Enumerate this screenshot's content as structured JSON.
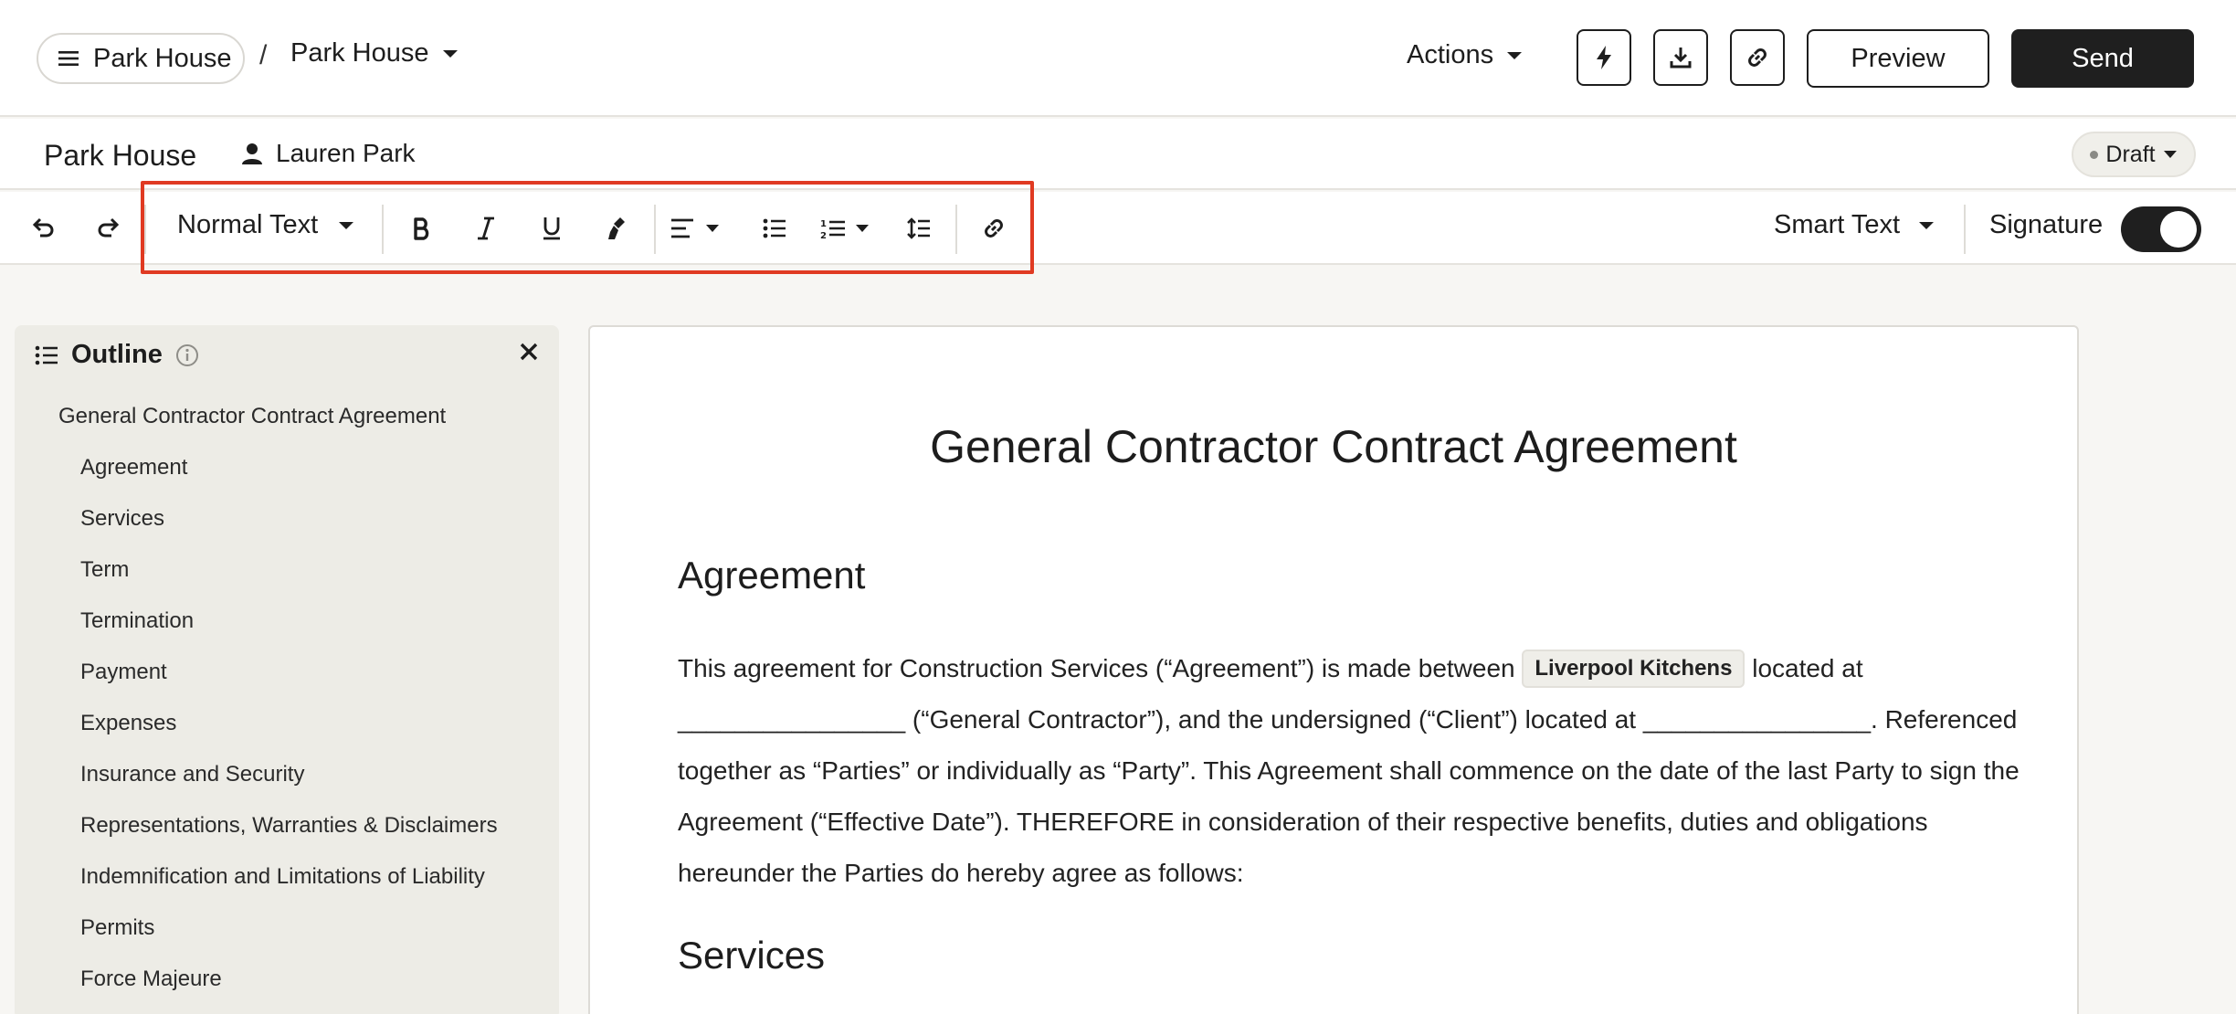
{
  "topbar": {
    "breadcrumb_root": "Park House",
    "breadcrumb_separator": "/",
    "breadcrumb_current": "Park House",
    "actions_label": "Actions",
    "preview_label": "Preview",
    "send_label": "Send",
    "icons": [
      "menu-icon",
      "lightning-icon",
      "download-icon",
      "link-icon",
      "caret-down-icon"
    ]
  },
  "docbar": {
    "document_name": "Park House",
    "owner_name": "Lauren Park",
    "status": "Draft"
  },
  "toolbar": {
    "text_style": "Normal Text",
    "smart_text_label": "Smart Text",
    "signature_label": "Signature",
    "signature_enabled": true,
    "icons": [
      "undo-icon",
      "redo-icon",
      "bold-icon",
      "italic-icon",
      "underline-icon",
      "clear-format-icon",
      "align-left-icon",
      "bullet-list-icon",
      "numbered-list-icon",
      "line-spacing-icon",
      "link-icon"
    ]
  },
  "outline": {
    "title": "Outline",
    "items": [
      {
        "label": "General Contractor Contract Agreement",
        "level": 1
      },
      {
        "label": "Agreement",
        "level": 2
      },
      {
        "label": "Services",
        "level": 2
      },
      {
        "label": "Term",
        "level": 2
      },
      {
        "label": "Termination",
        "level": 2
      },
      {
        "label": "Payment",
        "level": 2
      },
      {
        "label": "Expenses",
        "level": 2
      },
      {
        "label": "Insurance and Security",
        "level": 2
      },
      {
        "label": "Representations, Warranties & Disclaimers",
        "level": 2
      },
      {
        "label": "Indemnification and Limitations of Liability",
        "level": 2
      },
      {
        "label": "Permits",
        "level": 2
      },
      {
        "label": "Force Majeure",
        "level": 2
      }
    ]
  },
  "document": {
    "title": "General Contractor Contract Agreement",
    "section_agreement": "Agreement",
    "para_part1": "This agreement for Construction Services (“Agreement”) is made between",
    "contractor_chip": "Liverpool Kitchens",
    "para_part2": "located at ________________ (“General Contractor”), and the undersigned (“Client”) located at ________________. Referenced together as “Parties” or individually as “Party”. This Agreement shall commence on the date of the last Party to sign the Agreement (“Effective Date”). THEREFORE in consideration of their respective benefits, duties and obligations hereunder the Parties do hereby agree as follows:",
    "section_services": "Services"
  },
  "colors": {
    "accent_dark": "#1f1f1f",
    "highlight_border": "#e03a22",
    "sidebar_bg": "#edece6"
  }
}
